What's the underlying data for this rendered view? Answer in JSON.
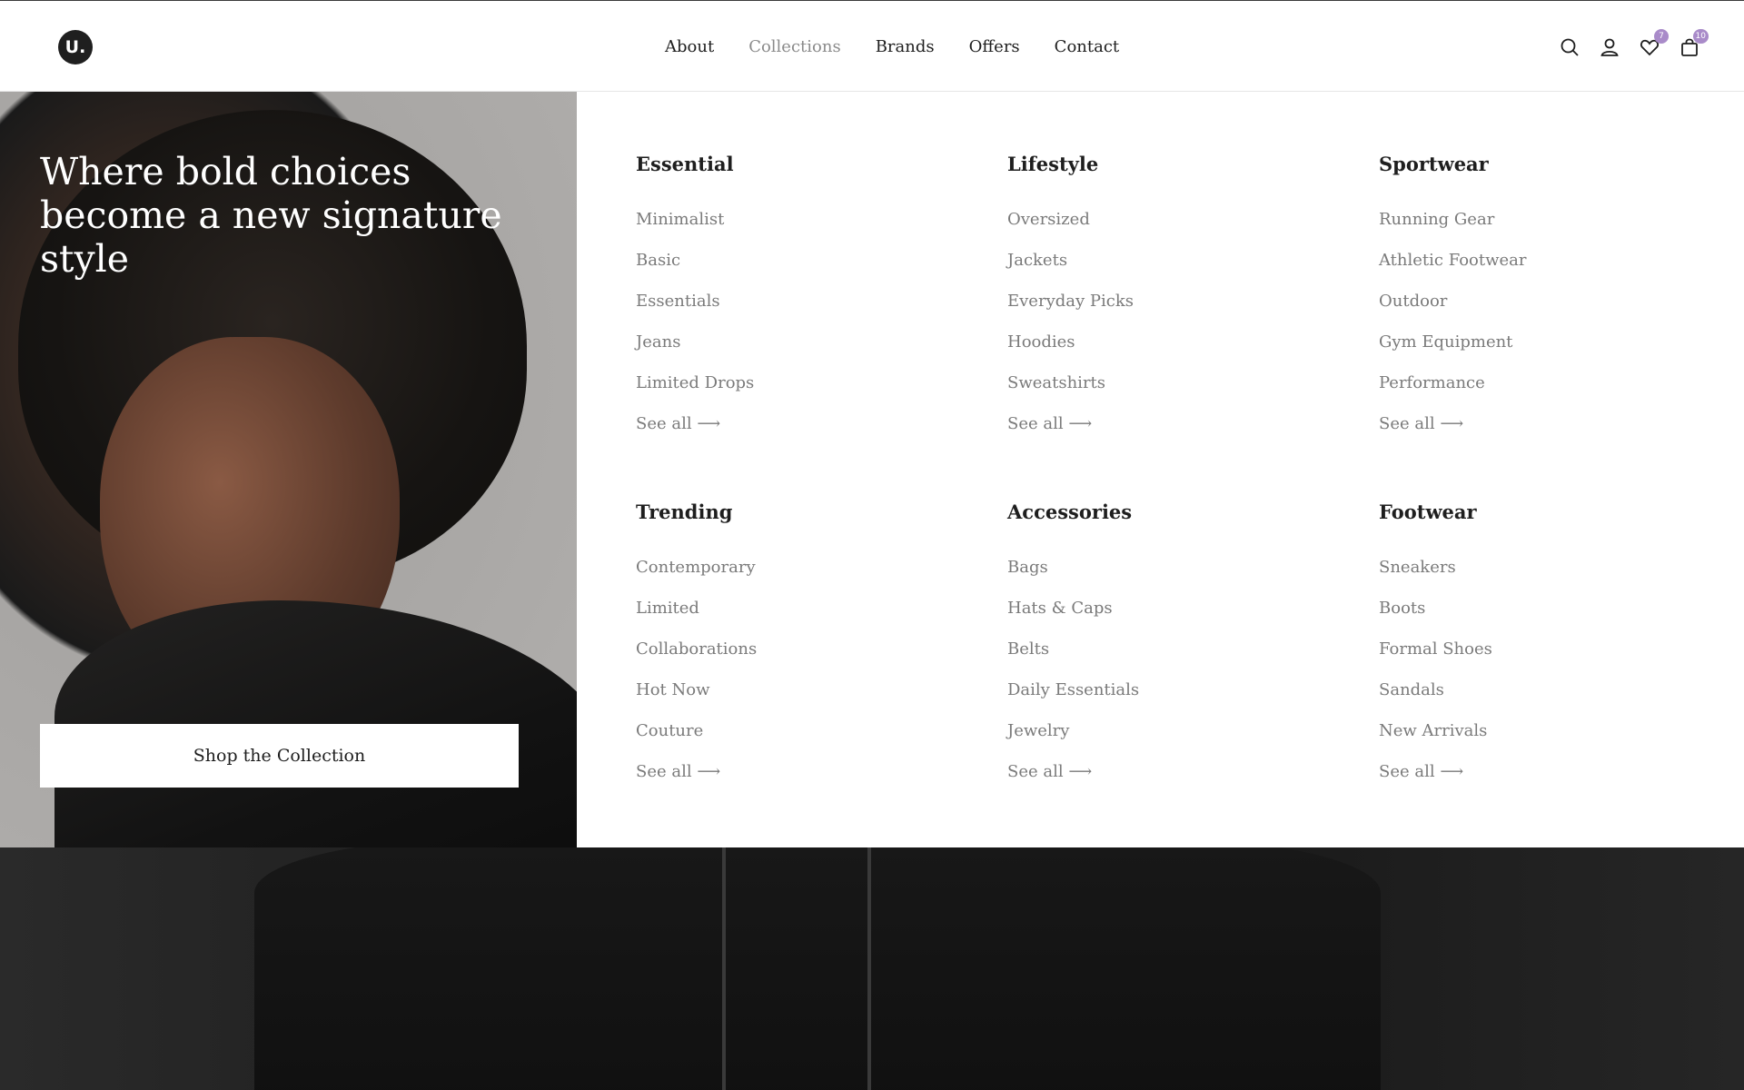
{
  "brand": {
    "logo_text": "U."
  },
  "nav": {
    "items": [
      {
        "label": "About"
      },
      {
        "label": "Collections"
      },
      {
        "label": "Brands"
      },
      {
        "label": "Offers"
      },
      {
        "label": "Contact"
      }
    ],
    "active": "Collections"
  },
  "header_icons": {
    "search": "search-icon",
    "account": "user-icon",
    "wishlist": "heart-icon",
    "wishlist_count": "7",
    "cart": "bag-icon",
    "cart_count": "10",
    "badge_color": "#a98bc9"
  },
  "hero": {
    "headline": "Where bold choices become a new signature style",
    "cta_label": "Shop the Collection"
  },
  "menu": {
    "columns": [
      {
        "title": "Essential",
        "items": [
          "Minimalist",
          "Basic",
          "Essentials",
          "Jeans",
          "Limited Drops",
          "See all ⟶"
        ]
      },
      {
        "title": "Lifestyle",
        "items": [
          "Oversized",
          "Jackets",
          "Everyday Picks",
          "Hoodies",
          "Sweatshirts",
          "See all ⟶"
        ]
      },
      {
        "title": "Sportwear",
        "items": [
          "Running Gear",
          "Athletic Footwear",
          "Outdoor",
          "Gym Equipment",
          "Performance",
          "See all ⟶"
        ]
      },
      {
        "title": "Trending",
        "items": [
          "Contemporary",
          "Limited",
          "Collaborations",
          "Hot Now",
          "Couture",
          "See all ⟶"
        ]
      },
      {
        "title": "Accessories",
        "items": [
          "Bags",
          "Hats & Caps",
          "Belts",
          "Daily Essentials",
          "Jewelry",
          "See all ⟶"
        ]
      },
      {
        "title": "Footwear",
        "items": [
          "Sneakers",
          "Boots",
          "Formal Shoes",
          "Sandals",
          "New Arrivals",
          "See all ⟶"
        ]
      }
    ]
  }
}
